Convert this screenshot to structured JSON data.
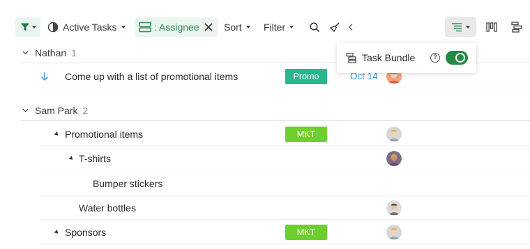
{
  "toolbar": {
    "filter_icon": "funnel-icon",
    "active_tasks_label": "Active Tasks",
    "assignee_label": ": Assignee",
    "sort_label": "Sort",
    "filter_label": "Filter",
    "accent": "#2e8b57"
  },
  "popover": {
    "label": "Task Bundle",
    "help_glyph": "?",
    "toggle_on": true,
    "toggle_color": "#238a45"
  },
  "groups": [
    {
      "name": "Nathan",
      "count": "1"
    },
    {
      "name": "Sam Park",
      "count": "2"
    }
  ],
  "rows": [
    {
      "title": "Come up with a list of promotional items",
      "tag": "Promo",
      "tag_color": "#2bb58f",
      "date": "Oct 14"
    },
    {
      "title": "Promotional items",
      "tag": "MKT",
      "tag_color": "#6ccf2d"
    },
    {
      "title": "T-shirts"
    },
    {
      "title": "Bumper stickers"
    },
    {
      "title": "Water bottles"
    },
    {
      "title": "Sponsors",
      "tag": "MKT",
      "tag_color": "#6ccf2d"
    }
  ]
}
